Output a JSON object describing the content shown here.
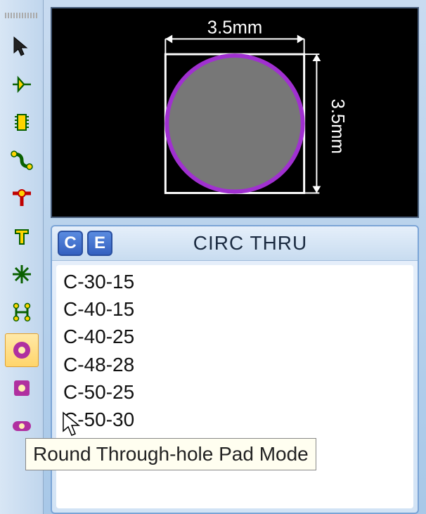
{
  "preview": {
    "width_label": "3.5mm",
    "height_label": "3.5mm"
  },
  "list": {
    "title": "CIRC THRU",
    "clone_label": "C",
    "edit_label": "E",
    "items": [
      "C-30-15",
      "C-40-15",
      "C-40-25",
      "C-48-28",
      "C-50-25",
      "C-50-30"
    ]
  },
  "tooltip": "Round Through-hole Pad Mode",
  "toolbar": {
    "items": [
      "select-tool-icon",
      "gate-tool-icon",
      "dip-tool-icon",
      "trace-tool-icon",
      "tee-tool-icon",
      "text-tool-icon",
      "star-tool-icon",
      "h-tool-icon",
      "round-pad-icon",
      "square-pad-icon",
      "oblong-pad-icon"
    ],
    "active_index": 8
  }
}
